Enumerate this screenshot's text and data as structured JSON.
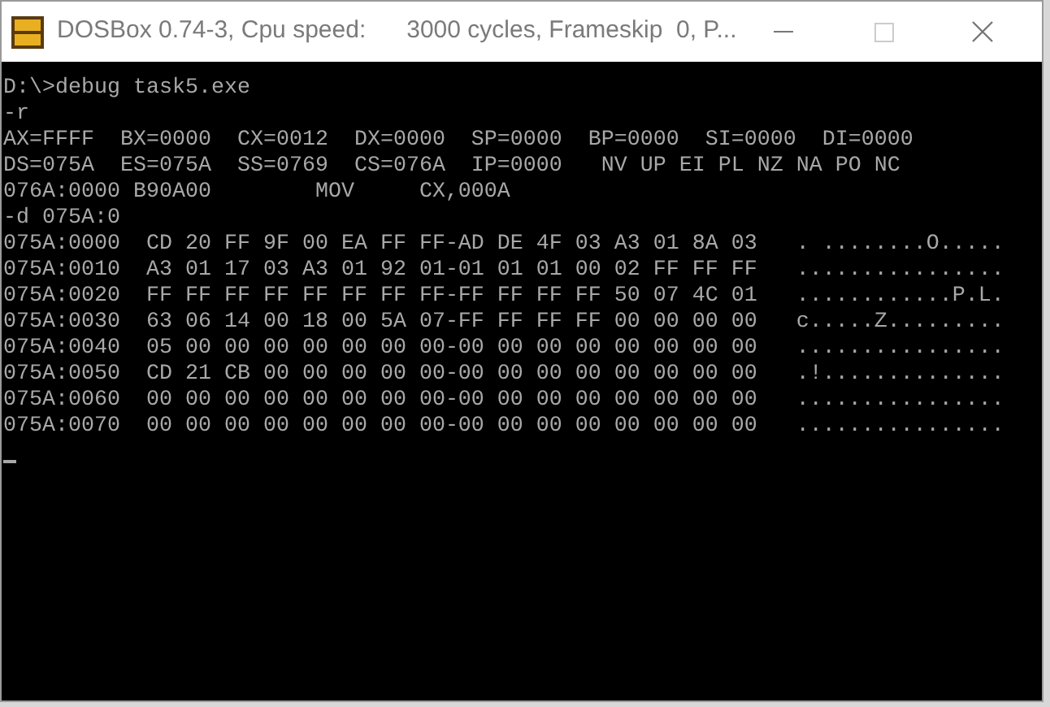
{
  "window": {
    "title": "DOSBox 0.74-3, Cpu speed:      3000 cycles, Frameskip  0, P..."
  },
  "terminal": {
    "lines": [
      "D:\\>debug task5.exe",
      "-r",
      "AX=FFFF  BX=0000  CX=0012  DX=0000  SP=0000  BP=0000  SI=0000  DI=0000",
      "DS=075A  ES=075A  SS=0769  CS=076A  IP=0000   NV UP EI PL NZ NA PO NC",
      "076A:0000 B90A00        MOV     CX,000A",
      "-d 075A:0",
      "075A:0000  CD 20 FF 9F 00 EA FF FF-AD DE 4F 03 A3 01 8A 03   . ........O.....",
      "075A:0010  A3 01 17 03 A3 01 92 01-01 01 01 00 02 FF FF FF   ................",
      "075A:0020  FF FF FF FF FF FF FF FF-FF FF FF FF 50 07 4C 01   ............P.L.",
      "075A:0030  63 06 14 00 18 00 5A 07-FF FF FF FF 00 00 00 00   c.....Z.........",
      "075A:0040  05 00 00 00 00 00 00 00-00 00 00 00 00 00 00 00   ................",
      "075A:0050  CD 21 CB 00 00 00 00 00-00 00 00 00 00 00 00 00   .!..............",
      "075A:0060  00 00 00 00 00 00 00 00-00 00 00 00 00 00 00 00   ................",
      "075A:0070  00 00 00 00 00 00 00 00-00 00 00 00 00 00 00 00   ................"
    ]
  }
}
